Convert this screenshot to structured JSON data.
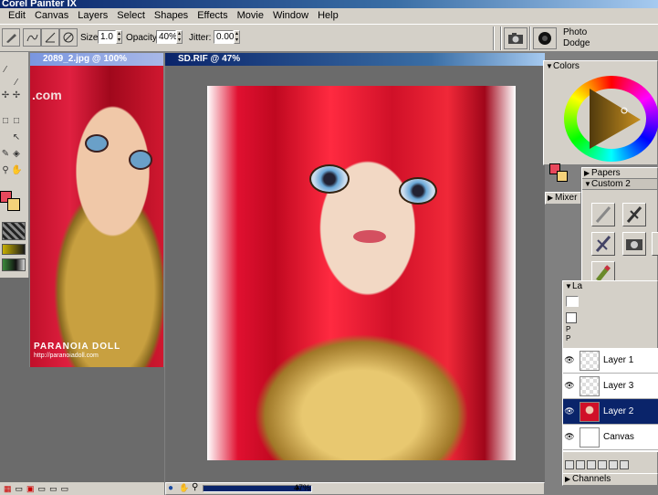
{
  "app": {
    "title": "Corel Painter IX"
  },
  "menu": [
    "Edit",
    "Canvas",
    "Layers",
    "Select",
    "Shapes",
    "Effects",
    "Movie",
    "Window",
    "Help"
  ],
  "properties": {
    "size_label": "Size:",
    "size_value": "1.0",
    "opacity_label": "Opacity:",
    "opacity_value": "40%",
    "jitter_label": "Jitter:",
    "jitter_value": "0.00",
    "brush_category": "Photo",
    "brush_variant": "Dodge"
  },
  "ref_window": {
    "title": "2089_2.jpg @ 100%",
    "watermark_top": ".com",
    "watermark_brand": "PARANOIA DOLL",
    "watermark_url": "http://paranoiadoll.com"
  },
  "doc_window": {
    "title": "SD.RIF @ 47%",
    "zoom": "47%"
  },
  "colors": {
    "panel_title": "Colors",
    "primary": "#e8485c",
    "secondary": "#f5d27a",
    "accent_selection": "#0a246a"
  },
  "papers_panel": {
    "title": "Papers"
  },
  "mixer_panel": {
    "title": "Mixer"
  },
  "custom_panel": {
    "title": "Custom  2"
  },
  "layers_panel": {
    "title": "La",
    "items": [
      {
        "name": "Layer 1",
        "selected": false
      },
      {
        "name": "Layer 3",
        "selected": false
      },
      {
        "name": "Layer 2",
        "selected": true
      },
      {
        "name": "Canvas",
        "selected": false
      }
    ]
  },
  "channels_panel": {
    "title": "Channels"
  },
  "icons": [
    "brush-icon",
    "camera-icon",
    "paper-icon",
    "eye-icon",
    "zoom-icon",
    "hand-icon",
    "globe-icon"
  ]
}
